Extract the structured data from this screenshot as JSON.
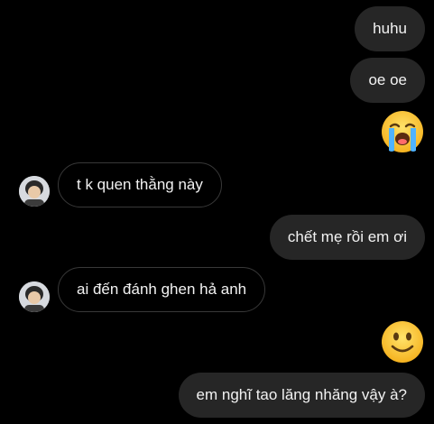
{
  "conversation": {
    "messages": [
      {
        "sender": "me",
        "type": "text",
        "text": "huhu"
      },
      {
        "sender": "me",
        "type": "text",
        "text": "oe oe"
      },
      {
        "sender": "me",
        "type": "emoji",
        "emoji": "loudly-crying-face"
      },
      {
        "sender": "them",
        "type": "text",
        "text": "t k quen thằng này"
      },
      {
        "sender": "me",
        "type": "text",
        "text": "chết mẹ rồi em ơi"
      },
      {
        "sender": "them",
        "type": "text",
        "text": "ai đến đánh ghen hả anh"
      },
      {
        "sender": "me",
        "type": "emoji",
        "emoji": "slightly-smiling-face"
      },
      {
        "sender": "me",
        "type": "text",
        "text": "em nghĩ tao lăng nhăng vậy à?"
      }
    ]
  },
  "colors": {
    "background": "#000000",
    "sent_bubble": "#262626",
    "received_border": "#383838",
    "text": "#f2f2f2"
  }
}
